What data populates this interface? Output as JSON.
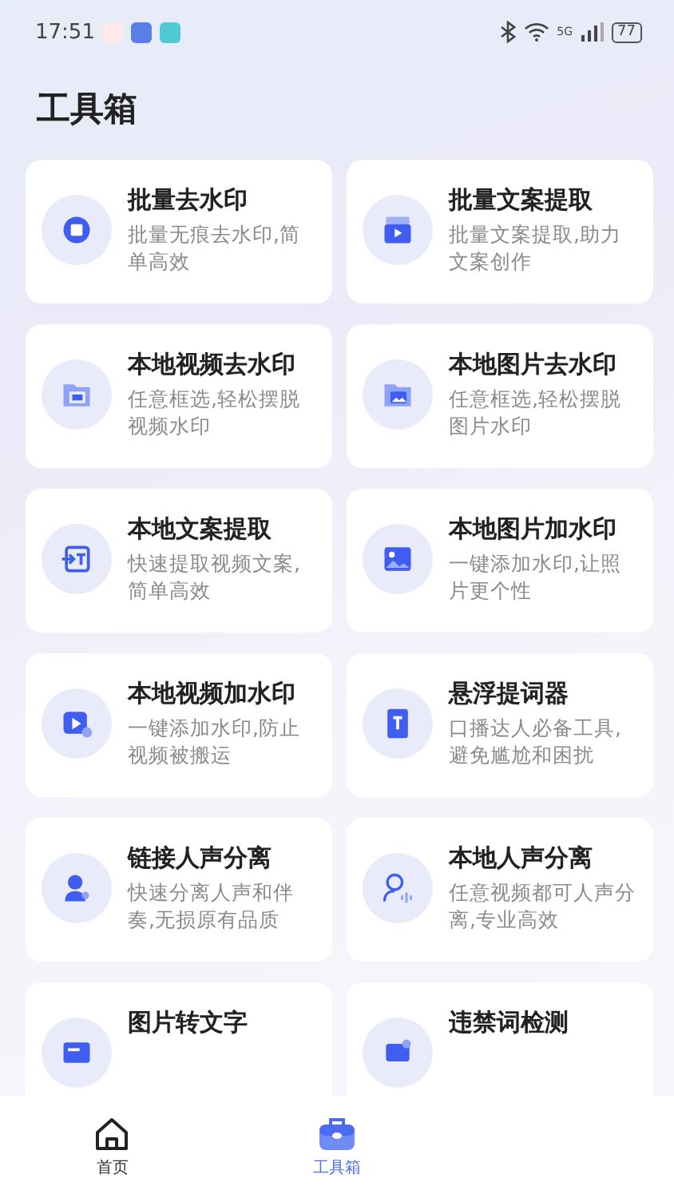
{
  "status_bar": {
    "time": "17:51",
    "network": "5G",
    "battery": "77"
  },
  "title": "工具箱",
  "tools": [
    {
      "title": "批量去水印",
      "desc": "批量无痕去水印,简单高效"
    },
    {
      "title": "批量文案提取",
      "desc": "批量文案提取,助力文案创作"
    },
    {
      "title": "本地视频去水印",
      "desc": "任意框选,轻松摆脱视频水印"
    },
    {
      "title": "本地图片去水印",
      "desc": "任意框选,轻松摆脱图片水印"
    },
    {
      "title": "本地文案提取",
      "desc": "快速提取视频文案,简单高效"
    },
    {
      "title": "本地图片加水印",
      "desc": "一键添加水印,让照片更个性"
    },
    {
      "title": "本地视频加水印",
      "desc": "一键添加水印,防止视频被搬运"
    },
    {
      "title": "悬浮提词器",
      "desc": "口播达人必备工具,避免尴尬和困扰"
    },
    {
      "title": "链接人声分离",
      "desc": "快速分离人声和伴奏,无损原有品质"
    },
    {
      "title": "本地人声分离",
      "desc": "任意视频都可人声分离,专业高效"
    },
    {
      "title": "图片转文字"
    },
    {
      "title": "违禁词检测"
    }
  ],
  "nav": [
    {
      "label": "首页",
      "selected": false
    },
    {
      "label": "工具箱",
      "selected": true
    }
  ]
}
